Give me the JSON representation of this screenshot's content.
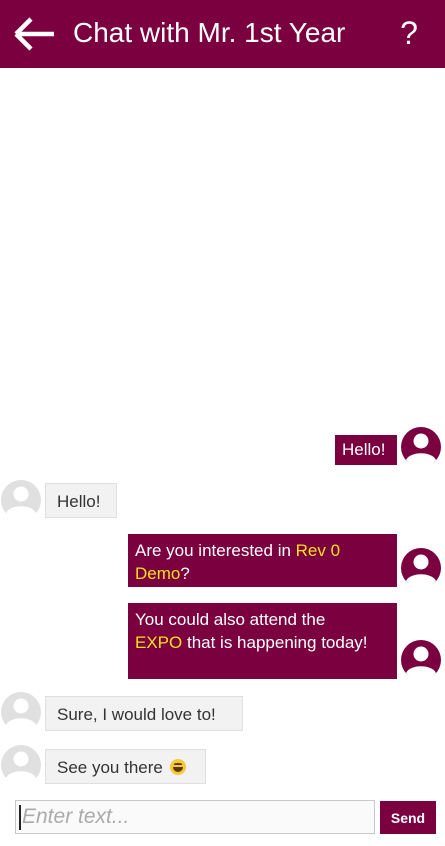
{
  "header": {
    "back_icon": "arrow-left-icon",
    "title": "Chat with Mr. 1st Year",
    "help_label": "?"
  },
  "messages": [
    {
      "sender": "user",
      "parts": [
        "Hello!"
      ]
    },
    {
      "sender": "bot",
      "parts": [
        "Hello!"
      ]
    },
    {
      "sender": "user",
      "parts": [
        "Are you interested in ",
        "Rev 0 Demo",
        "?"
      ],
      "highlight": [
        "Rev 0",
        "Demo"
      ]
    },
    {
      "sender": "user",
      "parts": [
        "You could also attend the ",
        "EXPO",
        " that is happening today!"
      ]
    },
    {
      "sender": "bot",
      "parts": [
        "Sure, I would love to!"
      ]
    },
    {
      "sender": "bot",
      "parts": [
        "See you there"
      ],
      "emoji": "grinning-face-icon"
    }
  ],
  "composer": {
    "placeholder": "Enter text...",
    "send_label": "Send"
  },
  "colors": {
    "brand": "#7a0040",
    "highlight": "#f5e11a",
    "bot_bubble": "#f2f2f2"
  }
}
